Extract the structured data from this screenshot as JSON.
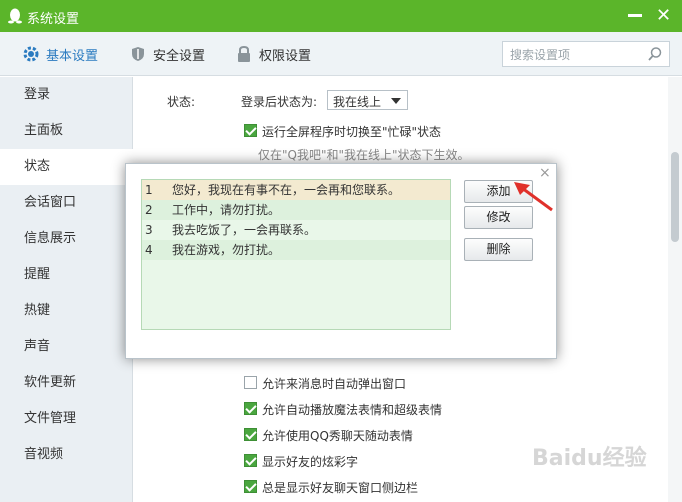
{
  "window": {
    "title": "系统设置",
    "close": "✕"
  },
  "toolbar": {
    "tabs": [
      {
        "label": "基本设置"
      },
      {
        "label": "安全设置"
      },
      {
        "label": "权限设置"
      }
    ],
    "search_placeholder": "搜索设置项"
  },
  "sidebar": {
    "items": [
      "登录",
      "主面板",
      "状态",
      "会话窗口",
      "信息展示",
      "提醒",
      "热键",
      "声音",
      "软件更新",
      "文件管理",
      "音视频"
    ],
    "selected": "状态"
  },
  "status": {
    "section_label": "状态:",
    "after_login_label": "登录后状态为:",
    "after_login_value": "我在线上",
    "fullscreen_busy": "运行全屏程序时切换至\"忙碌\"状态",
    "fullscreen_note": "仅在\"Q我吧\"和\"我在线上\"状态下生效。",
    "options": [
      {
        "label": "允许来消息时自动弹出窗口",
        "checked": false
      },
      {
        "label": "允许自动播放魔法表情和超级表情",
        "checked": true
      },
      {
        "label": "允许使用QQ秀聊天随动表情",
        "checked": true
      },
      {
        "label": "显示好友的炫彩字",
        "checked": true
      },
      {
        "label": "总是显示好友聊天窗口侧边栏",
        "checked": true
      }
    ]
  },
  "dialog": {
    "close": "×",
    "messages": [
      {
        "n": "1",
        "text": "您好，我现在有事不在，一会再和您联系。"
      },
      {
        "n": "2",
        "text": "工作中，请勿打扰。"
      },
      {
        "n": "3",
        "text": "我去吃饭了，一会再联系。"
      },
      {
        "n": "4",
        "text": "我在游戏，勿打扰。"
      }
    ],
    "buttons": {
      "add": "添加",
      "edit": "修改",
      "delete": "删除"
    }
  },
  "watermark": "Baidu经验",
  "colors": {
    "titlebar": "#5bb52a",
    "accent": "#2b7bc0",
    "check": "#4aa63f",
    "arrow": "#e0312b"
  }
}
